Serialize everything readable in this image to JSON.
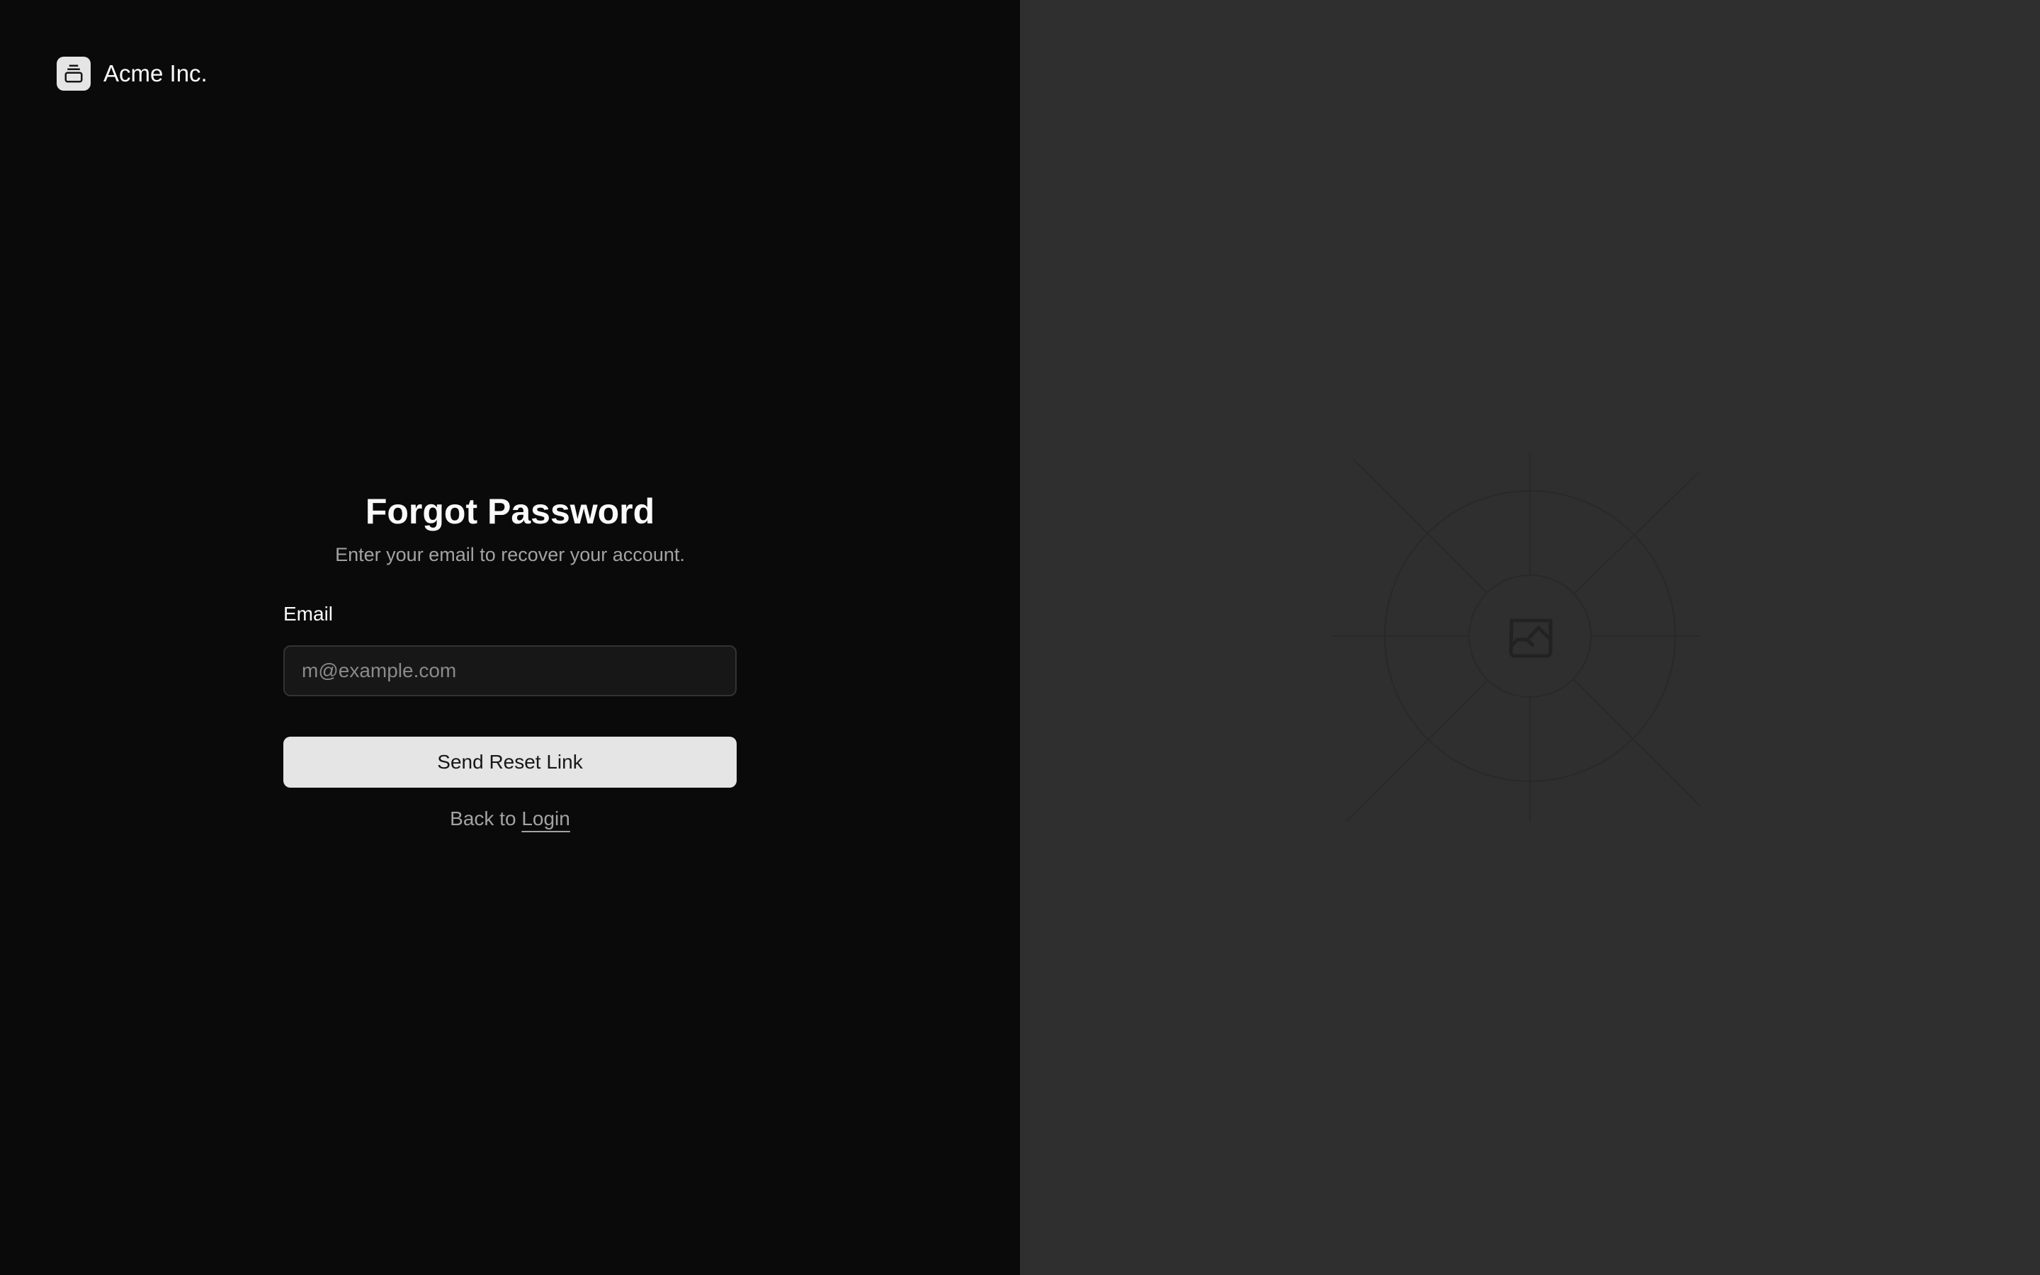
{
  "brand": {
    "name": "Acme Inc.",
    "icon": "gallery-icon"
  },
  "form": {
    "title": "Forgot Password",
    "subtitle": "Enter your email to recover your account.",
    "email_label": "Email",
    "email_placeholder": "m@example.com",
    "email_value": "",
    "submit_label": "Send Reset Link",
    "back_prefix": "Back to ",
    "back_link": "Login"
  },
  "placeholder": {
    "icon": "image-icon"
  }
}
